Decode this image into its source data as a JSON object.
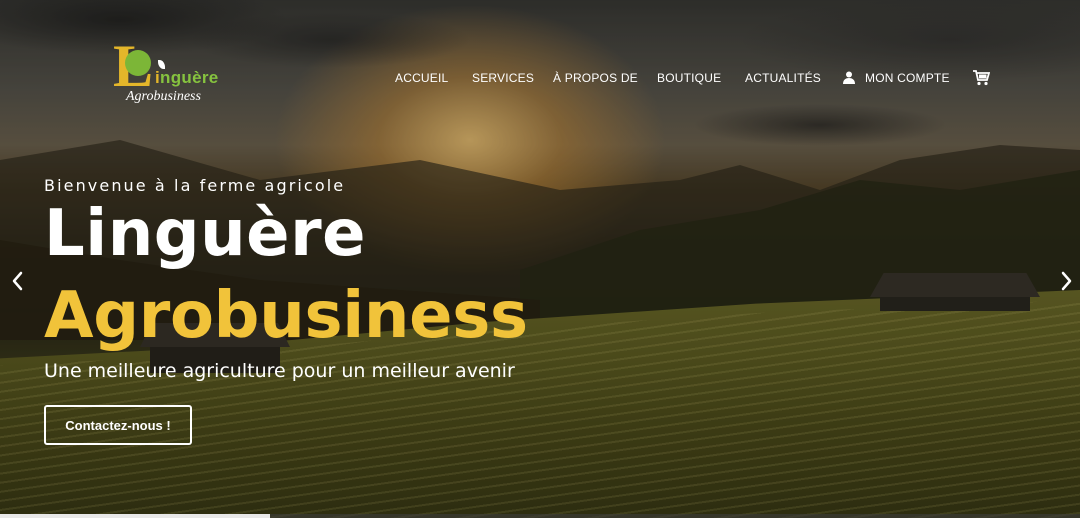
{
  "logo": {
    "letter": "L",
    "name_first": "i",
    "name_rest": "nguère",
    "subtitle": "Agrobusiness"
  },
  "nav": {
    "items": [
      "ACCUEIL",
      "SERVICES",
      "À PROPOS DE",
      "BOUTIQUE",
      "ACTUALITÉS"
    ],
    "account_label": "MON COMPTE",
    "account_icon": "user-icon",
    "cart_icon": "cart-icon"
  },
  "hero": {
    "welcome": "Bienvenue à la ferme agricole",
    "title_line1": "Linguère",
    "title_line2": "Agrobusiness",
    "tagline": "Une meilleure agriculture pour un meilleur avenir",
    "cta_label": "Contactez-nous !"
  },
  "slider": {
    "prev_icon": "chevron-left-icon",
    "next_icon": "chevron-right-icon",
    "progress": 0.25
  },
  "colors": {
    "accent": "#f1c33a",
    "logo_green": "#86c33f",
    "text": "#ffffff"
  }
}
